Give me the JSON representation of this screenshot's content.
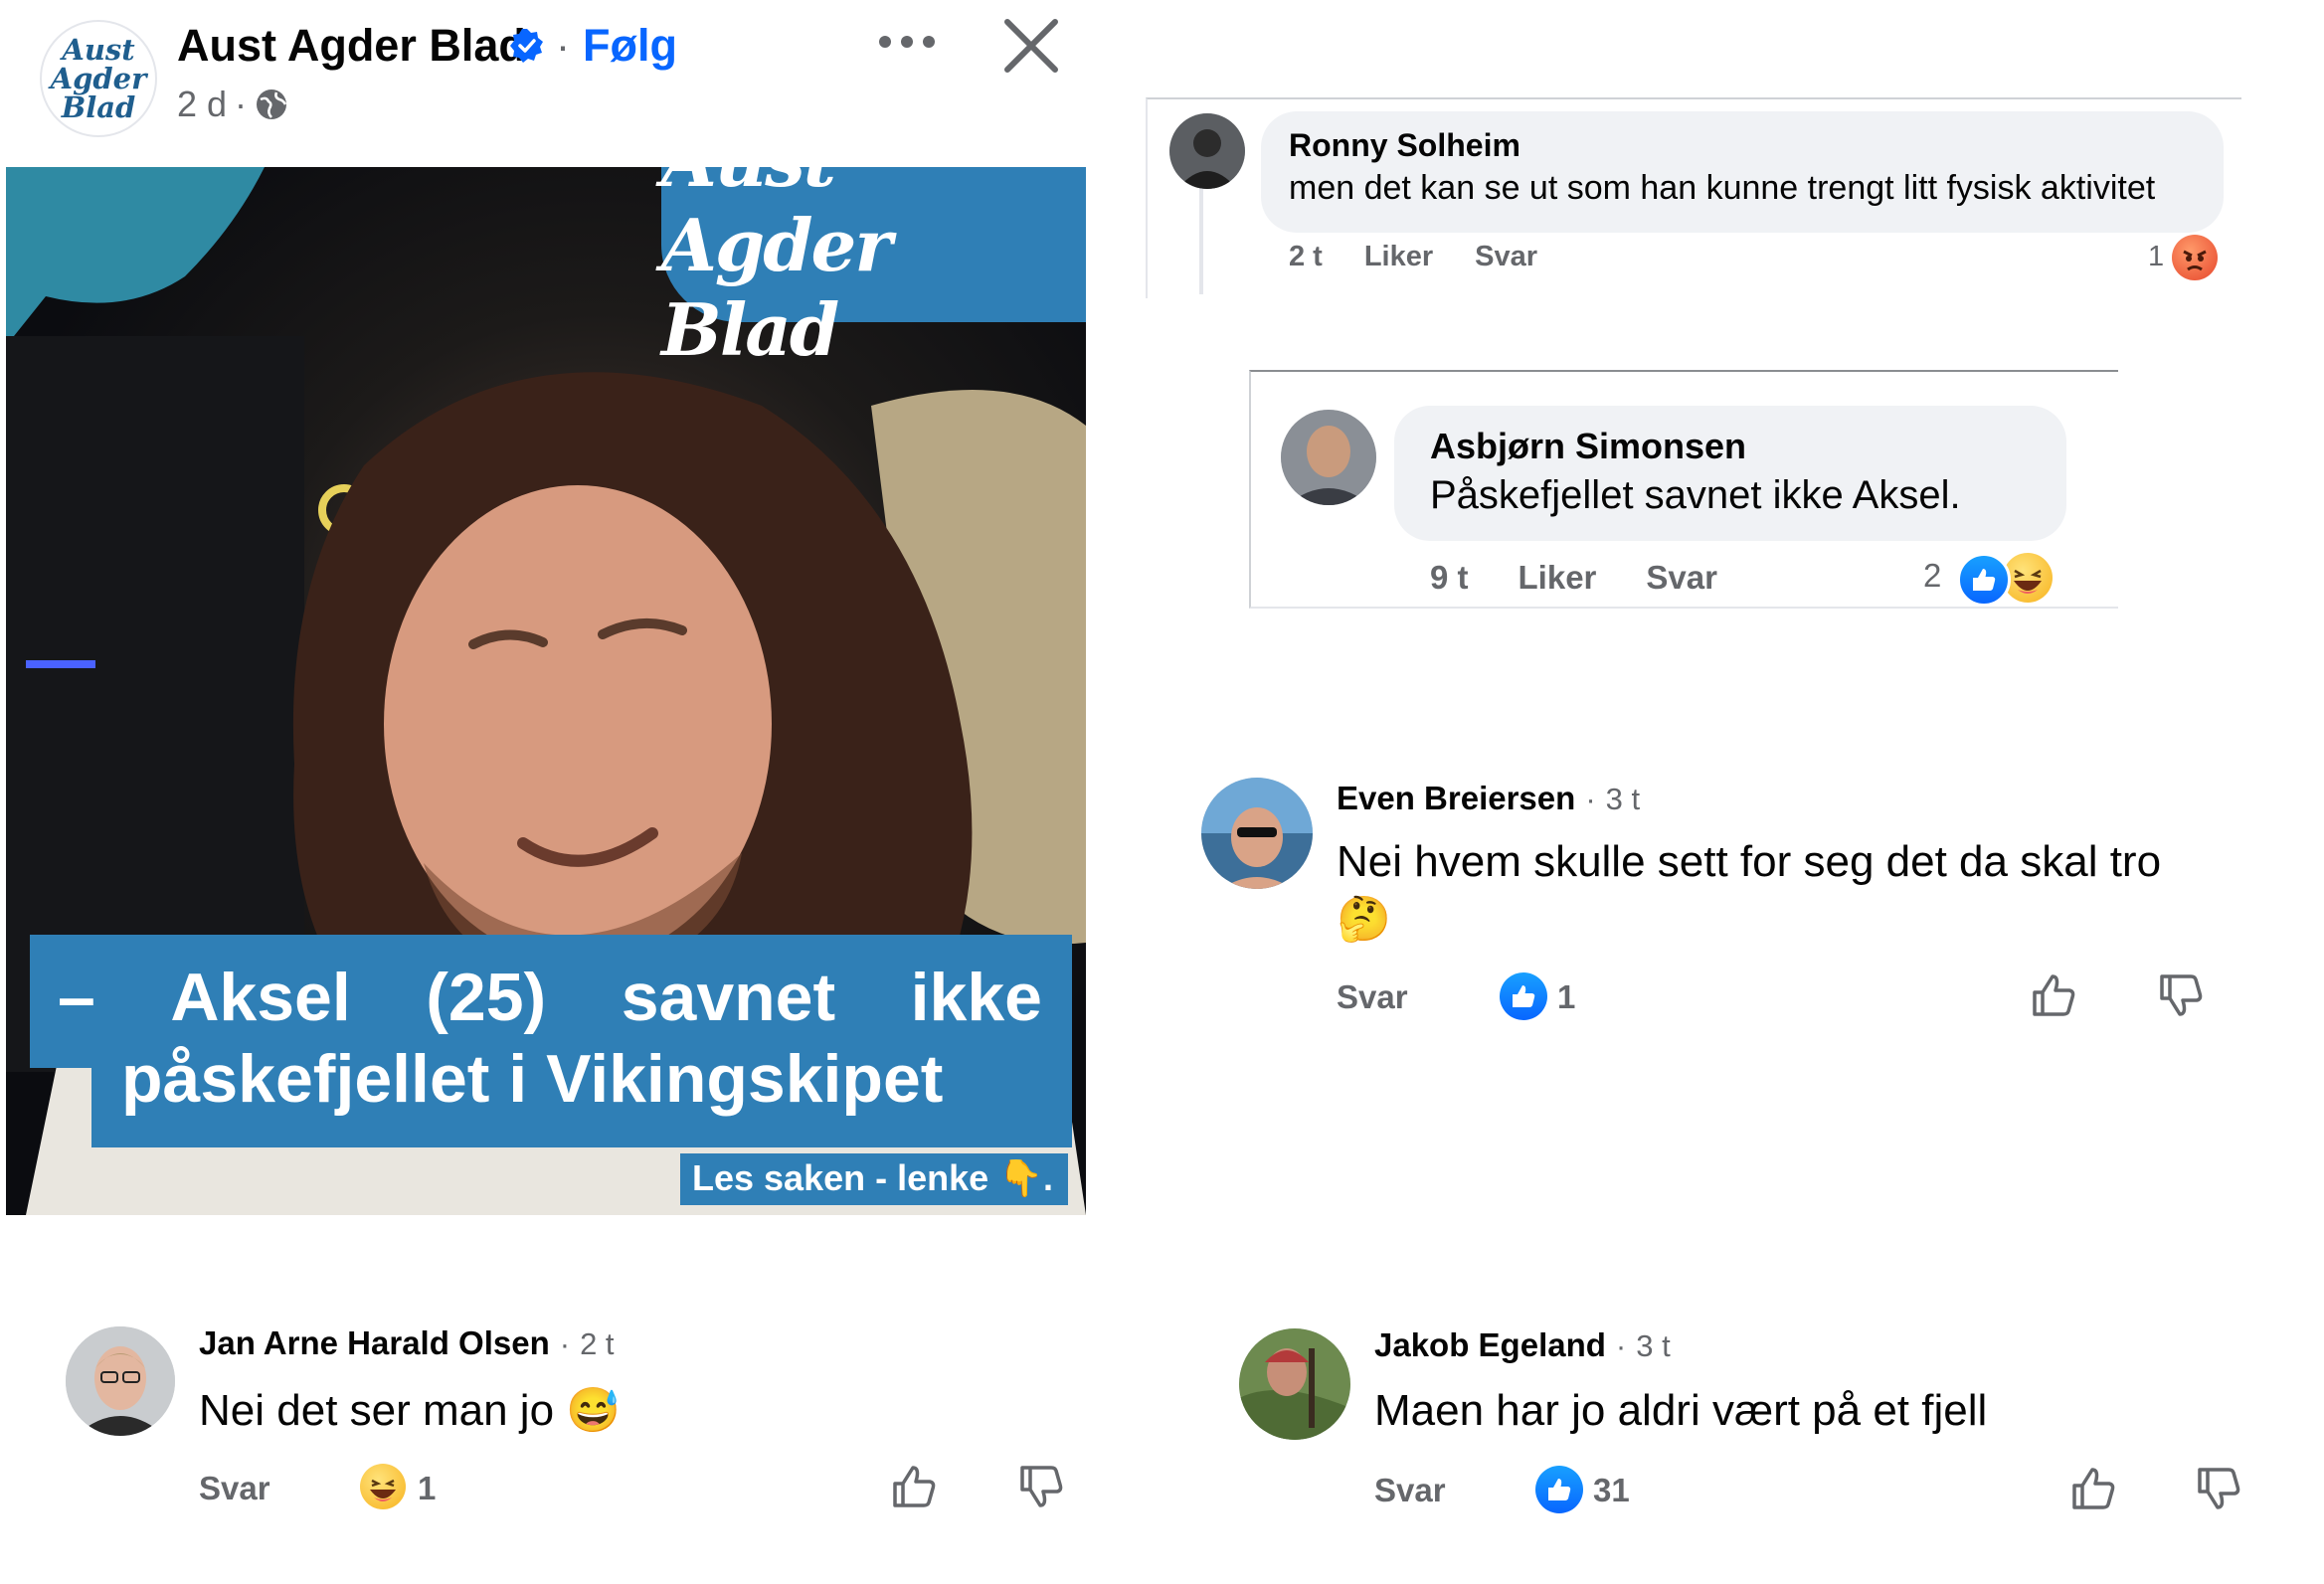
{
  "post": {
    "page_logo_text": "Aust Agder Blad",
    "page_name": "Aust Agder Blad",
    "follow_label": "Følg",
    "time": "2 d",
    "dot": "·",
    "image": {
      "brand": "Aust Agder Blad",
      "headline_words_line1": [
        "–",
        "Aksel",
        "(25)",
        "savnet",
        "ikke"
      ],
      "headline_line2": "påskefjellet i Vikingskipet",
      "read_more": "Les saken - lenke 👇."
    }
  },
  "comments": [
    {
      "name": "Jan Arne Harald Olsen",
      "time": "2 t",
      "text": "Nei det ser man jo 😅",
      "reply_label": "Svar",
      "reaction_count": "1"
    },
    {
      "name": "Even Breiersen",
      "time": "3 t",
      "text": "Nei hvem skulle sett for seg det da skal tro",
      "text_emoji": "🤔",
      "reply_label": "Svar",
      "reaction_count": "1"
    },
    {
      "name": "Jakob Egeland",
      "time": "3 t",
      "text": "Maen har jo aldri vært på et fjell",
      "reply_label": "Svar",
      "reaction_count": "31"
    }
  ],
  "screenshots": [
    {
      "name": "Ronny Solheim",
      "text": "men det kan se ut som han kunne trengt litt fysisk aktivitet",
      "time": "2 t",
      "like_label": "Liker",
      "reply_label": "Svar",
      "reaction_count": "1"
    },
    {
      "name": "Asbjørn Simonsen",
      "text": "Påskefjellet savnet ikke Aksel.",
      "time": "9 t",
      "like_label": "Liker",
      "reply_label": "Svar",
      "reaction_count": "2"
    }
  ],
  "colors": {
    "facebook_blue": "#0866ff",
    "brand_blue": "#2f7fb6",
    "secondary_text": "#65676b",
    "bubble_bg": "#f0f2f5"
  },
  "icons": {
    "verified": "verified-badge-icon",
    "globe": "globe-icon",
    "more": "more-dots-icon",
    "close": "close-icon",
    "like": "like-icon",
    "dislike": "dislike-icon"
  }
}
